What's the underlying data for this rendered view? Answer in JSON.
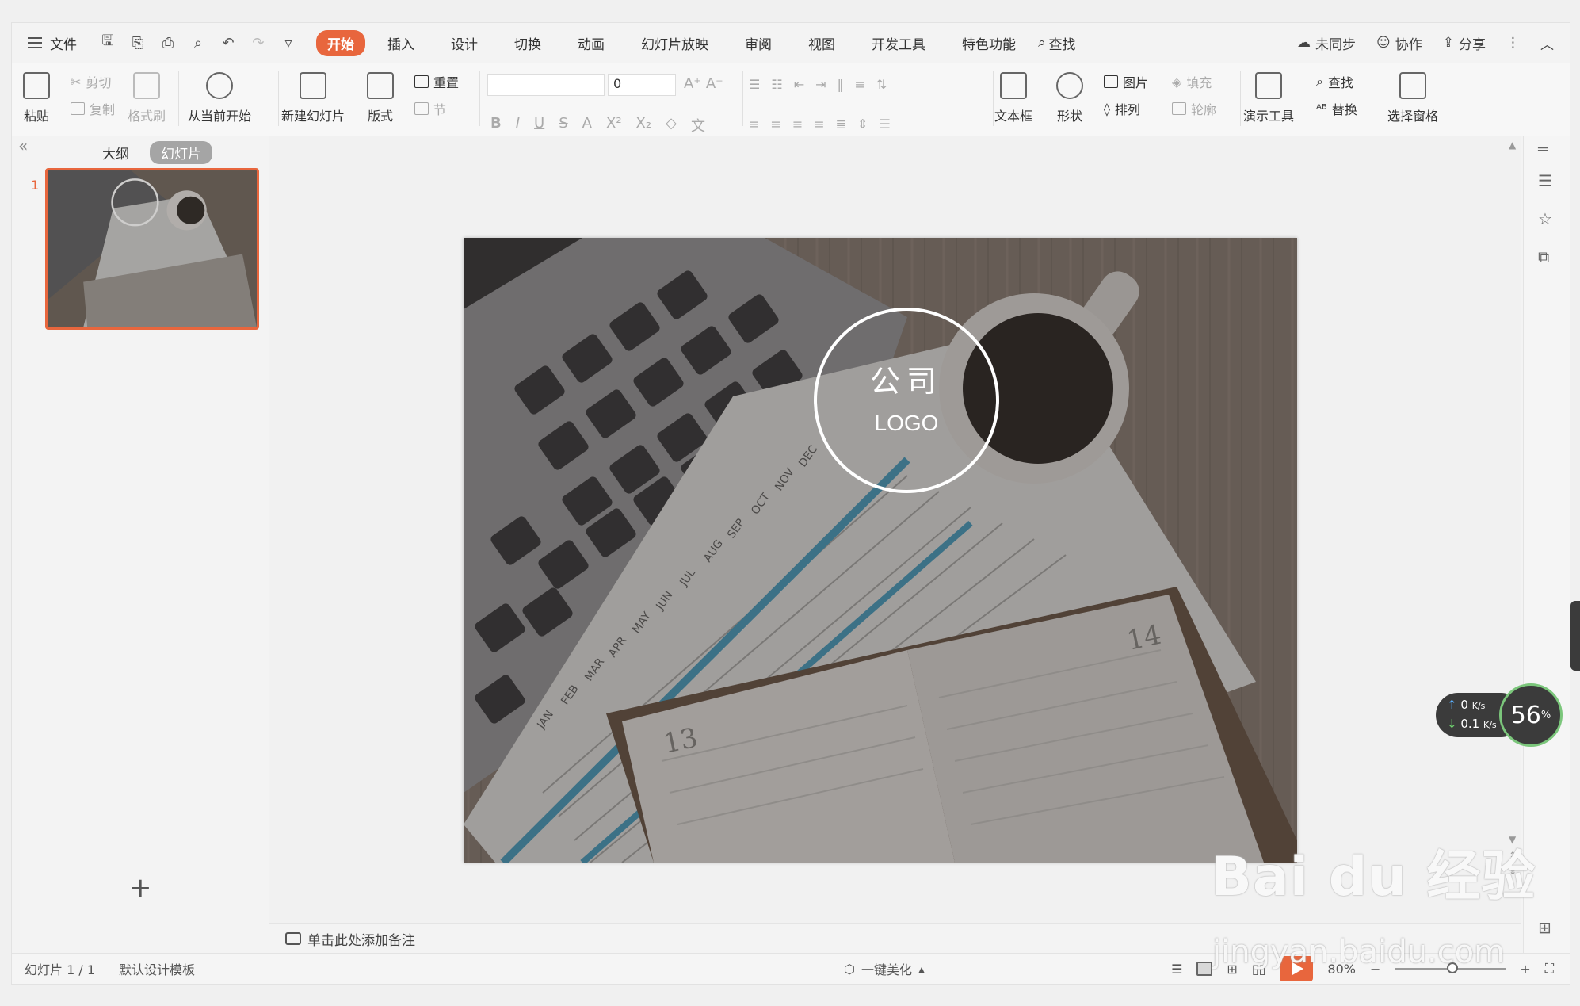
{
  "menubar": {
    "file": "文件",
    "tabs": [
      "开始",
      "插入",
      "设计",
      "切换",
      "动画",
      "幻灯片放映",
      "审阅",
      "视图",
      "开发工具",
      "特色功能"
    ],
    "search": "查找",
    "right": {
      "sync": "未同步",
      "collab": "协作",
      "share": "分享"
    }
  },
  "ribbon": {
    "paste": "粘贴",
    "cut": "剪切",
    "copy": "复制",
    "format_painter": "格式刷",
    "from_current": "从当前开始",
    "new_slide": "新建幻灯片",
    "layout": "版式",
    "reset": "重置",
    "section": "节",
    "font_size": "0",
    "text_box": "文本框",
    "shape": "形状",
    "picture": "图片",
    "fill": "填充",
    "arrange": "排列",
    "outline": "轮廓",
    "present_tool": "演示工具",
    "find": "查找",
    "replace": "替换",
    "select_pane": "选择窗格",
    "format_btns": [
      "B",
      "I",
      "U",
      "S",
      "A",
      "X²",
      "X₂"
    ]
  },
  "leftpanel": {
    "tab_outline": "大纲",
    "tab_slides": "幻灯片",
    "slide_number": "1",
    "add": "+"
  },
  "slide": {
    "logo_line1": "公司",
    "logo_line2": "LOGO",
    "months": [
      "JAN",
      "FEB",
      "MAR",
      "APR",
      "MAY",
      "JUN",
      "JUL",
      "AUG",
      "SEP",
      "OCT",
      "NOV",
      "DEC"
    ],
    "page_left": "13",
    "page_right": "14"
  },
  "notes": {
    "placeholder": "单击此处添加备注"
  },
  "statusbar": {
    "slide_info": "幻灯片 1 / 1",
    "template": "默认设计模板",
    "beautify": "一键美化",
    "zoom": "80%"
  },
  "network": {
    "up": "0",
    "down": "0.1",
    "unit": "K/s",
    "percent": "56",
    "percent_unit": "%"
  },
  "watermark": {
    "brand": "Bai du 经验",
    "url": "jingyan.baidu.com"
  },
  "colors": {
    "accent": "#e8663d",
    "panel": "#f3f3f3"
  }
}
